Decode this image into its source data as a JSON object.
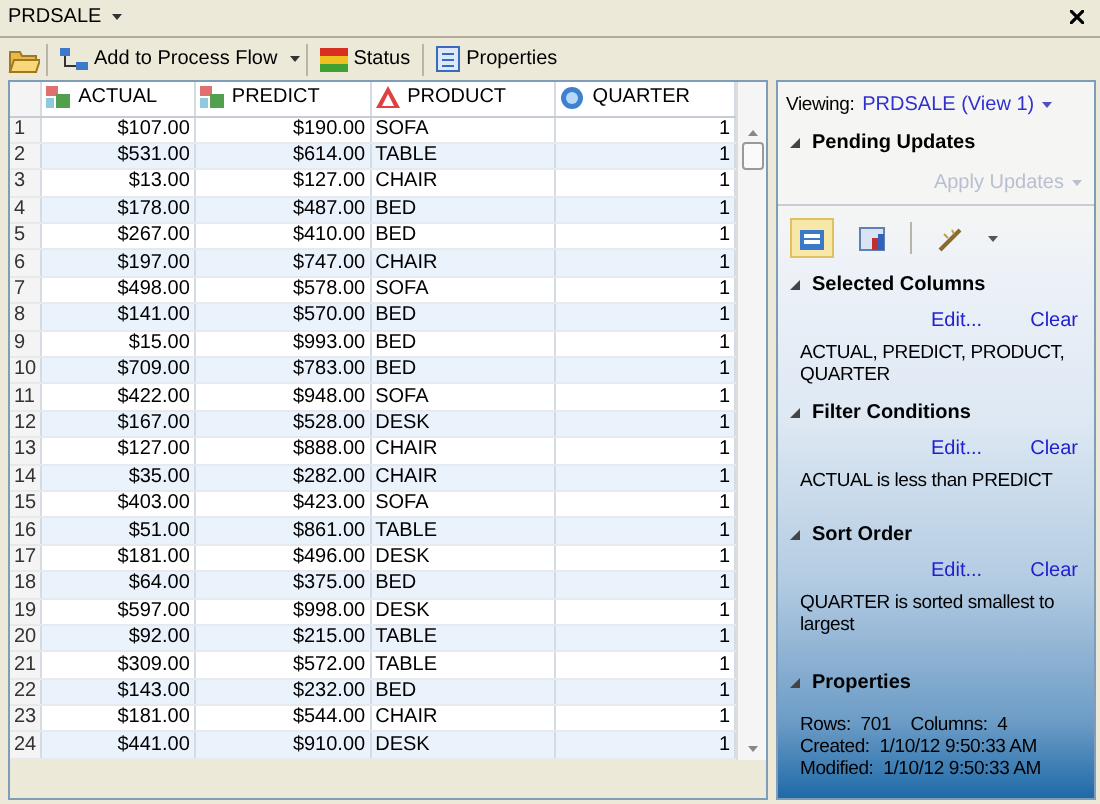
{
  "window": {
    "title": "PRDSALE"
  },
  "toolbar": [
    {
      "kind": "open"
    },
    {
      "kind": "flow",
      "label": "Add to Process Flow"
    },
    {
      "kind": "status",
      "label": "Status"
    },
    {
      "kind": "properties",
      "label": "Properties"
    }
  ],
  "table": {
    "columns": [
      {
        "label": "ACTUAL",
        "kind": "numeric"
      },
      {
        "label": "PREDICT",
        "kind": "numeric"
      },
      {
        "label": "PRODUCT",
        "kind": "character"
      },
      {
        "label": "QUARTER",
        "kind": "computed"
      }
    ],
    "rows": [
      {
        "number": "1",
        "cells": [
          "$107.00",
          "$190.00",
          "SOFA",
          "1"
        ]
      },
      {
        "number": "2",
        "cells": [
          "$531.00",
          "$614.00",
          "TABLE",
          "1"
        ]
      },
      {
        "number": "3",
        "cells": [
          "$13.00",
          "$127.00",
          "CHAIR",
          "1"
        ]
      },
      {
        "number": "4",
        "cells": [
          "$178.00",
          "$487.00",
          "BED",
          "1"
        ]
      },
      {
        "number": "5",
        "cells": [
          "$267.00",
          "$410.00",
          "BED",
          "1"
        ]
      },
      {
        "number": "6",
        "cells": [
          "$197.00",
          "$747.00",
          "CHAIR",
          "1"
        ]
      },
      {
        "number": "7",
        "cells": [
          "$498.00",
          "$578.00",
          "SOFA",
          "1"
        ]
      },
      {
        "number": "8",
        "cells": [
          "$141.00",
          "$570.00",
          "BED",
          "1"
        ]
      },
      {
        "number": "9",
        "cells": [
          "$15.00",
          "$993.00",
          "BED",
          "1"
        ]
      },
      {
        "number": "10",
        "cells": [
          "$709.00",
          "$783.00",
          "BED",
          "1"
        ]
      },
      {
        "number": "11",
        "cells": [
          "$422.00",
          "$948.00",
          "SOFA",
          "1"
        ]
      },
      {
        "number": "12",
        "cells": [
          "$167.00",
          "$528.00",
          "DESK",
          "1"
        ]
      },
      {
        "number": "13",
        "cells": [
          "$127.00",
          "$888.00",
          "CHAIR",
          "1"
        ]
      },
      {
        "number": "14",
        "cells": [
          "$35.00",
          "$282.00",
          "CHAIR",
          "1"
        ]
      },
      {
        "number": "15",
        "cells": [
          "$403.00",
          "$423.00",
          "SOFA",
          "1"
        ]
      },
      {
        "number": "16",
        "cells": [
          "$51.00",
          "$861.00",
          "TABLE",
          "1"
        ]
      },
      {
        "number": "17",
        "cells": [
          "$181.00",
          "$496.00",
          "DESK",
          "1"
        ]
      },
      {
        "number": "18",
        "cells": [
          "$64.00",
          "$375.00",
          "BED",
          "1"
        ]
      },
      {
        "number": "19",
        "cells": [
          "$597.00",
          "$998.00",
          "DESK",
          "1"
        ]
      },
      {
        "number": "20",
        "cells": [
          "$92.00",
          "$215.00",
          "TABLE",
          "1"
        ]
      },
      {
        "number": "21",
        "cells": [
          "$309.00",
          "$572.00",
          "TABLE",
          "1"
        ]
      },
      {
        "number": "22",
        "cells": [
          "$143.00",
          "$232.00",
          "BED",
          "1"
        ]
      },
      {
        "number": "23",
        "cells": [
          "$181.00",
          "$544.00",
          "CHAIR",
          "1"
        ]
      },
      {
        "number": "24",
        "cells": [
          "$441.00",
          "$910.00",
          "DESK",
          "1"
        ]
      }
    ]
  },
  "panel": {
    "viewing_label": "Viewing:",
    "view_name": "PRDSALE (View 1)",
    "pending": {
      "title": "Pending Updates",
      "expanded": true,
      "apply_button": {
        "label": "Apply Updates",
        "disabled": true
      }
    },
    "tools": [
      {
        "kind": "query",
        "selected": true
      },
      {
        "kind": "chart",
        "selected": false
      },
      {
        "kind": "wand",
        "selected": false
      }
    ],
    "sections": [
      {
        "title": "Selected Columns",
        "expanded": true,
        "edit": "Edit...",
        "clear": "Clear",
        "text": "ACTUAL, PREDICT, PRODUCT, QUARTER"
      },
      {
        "title": "Filter Conditions",
        "expanded": true,
        "edit": "Edit...",
        "clear": "Clear",
        "text": "ACTUAL is less than PREDICT"
      },
      {
        "title": "Sort Order",
        "expanded": true,
        "edit": "Edit...",
        "clear": "Clear",
        "text": "QUARTER is sorted smallest to largest"
      }
    ],
    "properties": {
      "title": "Properties",
      "expanded": true,
      "lines": [
        "Rows:  701    Columns:  4",
        "Created:  1/10/12 9:50:33 AM",
        "Modified:  1/10/12 9:50:33 AM"
      ]
    }
  }
}
